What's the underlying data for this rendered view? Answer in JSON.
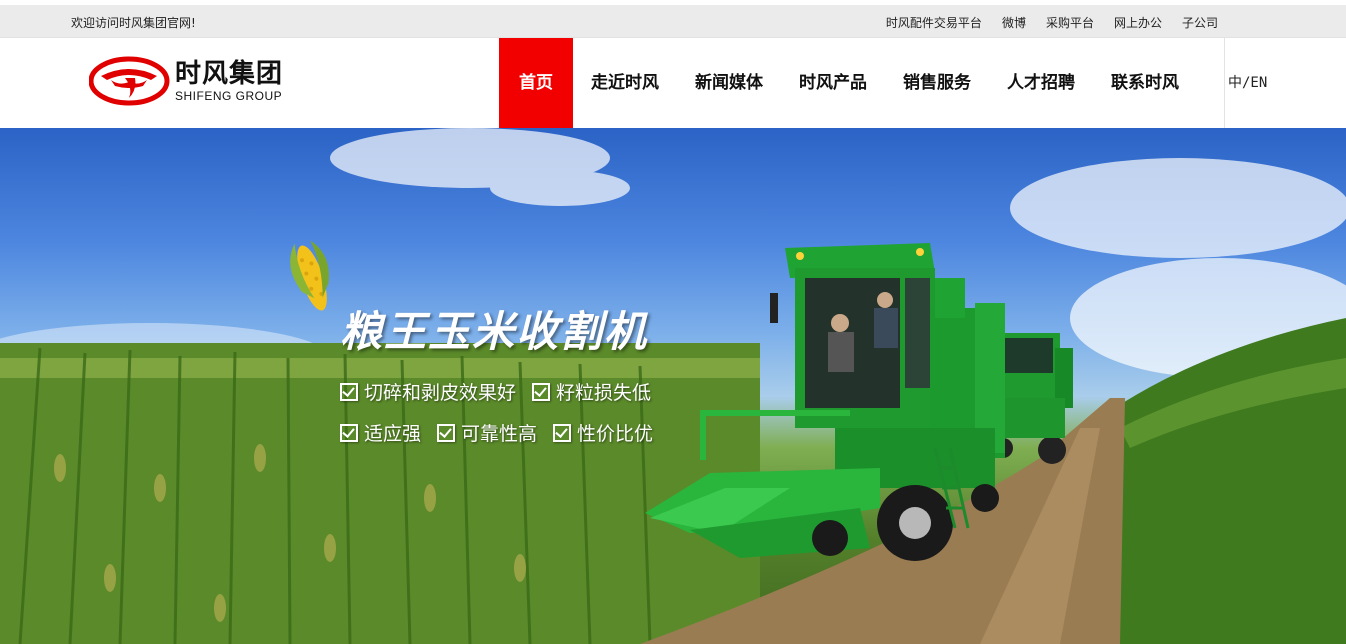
{
  "topbar": {
    "welcome": "欢迎访问时风集团官网!",
    "links": [
      "时风配件交易平台",
      "微博",
      "采购平台",
      "网上办公",
      "子公司"
    ]
  },
  "logo": {
    "name_cn": "时风集团",
    "name_en": "SHIFENG GROUP"
  },
  "nav": {
    "items": [
      "首页",
      "走近时风",
      "新闻媒体",
      "时风产品",
      "销售服务",
      "人才招聘",
      "联系时风"
    ],
    "active_index": 0,
    "language_switch": "中/EN"
  },
  "banner": {
    "headline": "粮王玉米收割机",
    "features": [
      [
        "切碎和剥皮效果好",
        "籽粒损失低"
      ],
      [
        "适应强",
        "可靠性高",
        "性价比优"
      ]
    ]
  },
  "colors": {
    "brand_red": "#f20000",
    "harvester_green": "#1f9a2f",
    "topbar_bg": "#ebebeb"
  }
}
